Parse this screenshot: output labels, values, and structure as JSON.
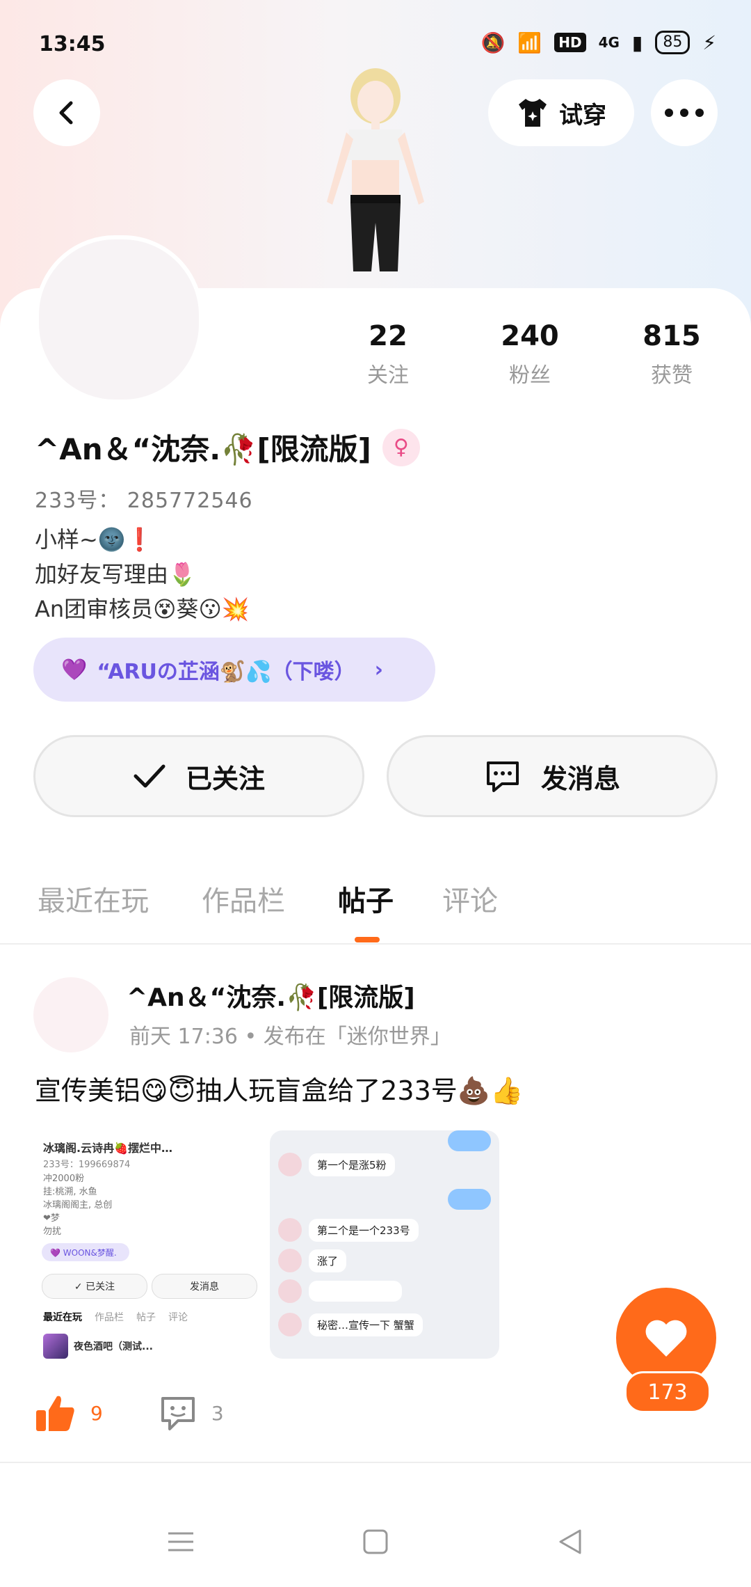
{
  "status_bar": {
    "time": "13:45",
    "hd": "HD",
    "network": "4G",
    "battery": "85"
  },
  "header": {
    "try_on_label": "试穿"
  },
  "stats": [
    {
      "value": "22",
      "label": "关注"
    },
    {
      "value": "240",
      "label": "粉丝"
    },
    {
      "value": "815",
      "label": "获赞"
    }
  ],
  "profile": {
    "username": "^An＆“沈奈.🥀[限流版]",
    "gender_symbol": "♀",
    "user_id": "233号： 285772546",
    "bio": [
      "小样~🌚❗",
      "加好友写理由🌷",
      "An团审核员😵葵😗💥"
    ],
    "club": "“ARUの芷涵🐒💦（下喽）"
  },
  "actions": {
    "follow_label": "已关注",
    "message_label": "发消息"
  },
  "tabs": [
    "最近在玩",
    "作品栏",
    "帖子",
    "评论"
  ],
  "post": {
    "author": "^An＆“沈奈.🥀[限流版]",
    "meta": "前天 17:36 • 发布在「迷你世界」",
    "text": "宣传美铝😋😇抽人玩盲盒给了233号💩👍",
    "like_count": "9",
    "comment_count": "3"
  },
  "thumb_left": {
    "name": "冰璃阁.云诗冉🍓摆烂中…",
    "id": "233号：199669874",
    "bio": [
      "冲2000粉",
      "挂:桃溯, 水鱼",
      "冰璃阁阁主, 总创",
      "❤梦",
      "勿扰"
    ],
    "club": "💜 WOON&梦醒.",
    "follow": "✓ 已关注",
    "message": "发消息",
    "tabs": [
      "最近在玩",
      "作品栏",
      "帖子",
      "评论"
    ],
    "game": "夜色酒吧（测试..."
  },
  "thumb_right": {
    "messages": [
      "第一个是涨5粉",
      "第二个是一个233号",
      "涨了",
      "秘密…宣传一下 蟹蟹"
    ]
  },
  "like_fab_count": "173",
  "colors": {
    "accent": "#ff6a1a",
    "club_bg": "#e8e4fb",
    "club_text": "#6a55e0"
  }
}
